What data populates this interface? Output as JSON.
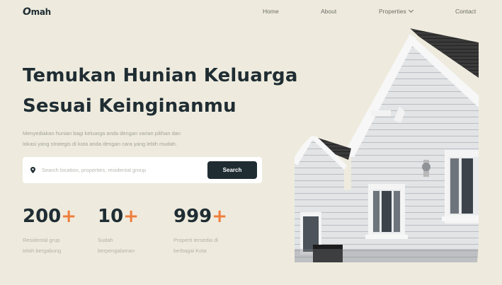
{
  "brand": {
    "logo_mark": "O",
    "logo_text": "mah"
  },
  "nav": {
    "home": "Home",
    "about": "About",
    "properties": "Properties",
    "contact": "Contact"
  },
  "hero": {
    "title_line1": "Temukan Hunian Keluarga",
    "title_line2": "Sesuai Keinginanmu",
    "desc_line1": "Menyediakan hunian bagi keluarga anda dengan varian pilihan dan",
    "desc_line2": "lokasi yang strategis di kota anda dengan cara yang lebih mudah."
  },
  "search": {
    "placeholder": "Search location, properties, residental group",
    "button_label": "Search",
    "icon": "location-pin-icon"
  },
  "stats": [
    {
      "value": "200",
      "suffix": "+",
      "label_line1": "Residental grup",
      "label_line2": "telah bergabung"
    },
    {
      "value": "10",
      "suffix": "+",
      "label_line1": "Sudah",
      "label_line2": "berpengalaman"
    },
    {
      "value": "999",
      "suffix": "+",
      "label_line1": "Properti tersedia di",
      "label_line2": "berbagai Kota"
    }
  ],
  "colors": {
    "background": "#eeebde",
    "primary": "#1f2d33",
    "accent": "#f07d3c",
    "muted_text": "#a4a39a"
  },
  "image": {
    "subject": "house-photo"
  }
}
